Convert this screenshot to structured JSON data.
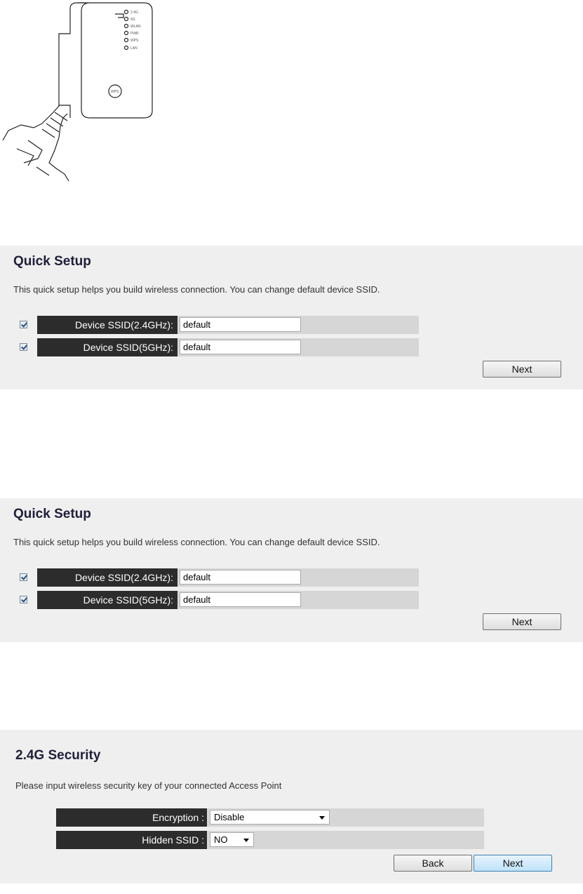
{
  "illustration": {
    "led_labels": [
      "2.4G",
      "5G",
      "WLAN",
      "PWR",
      "WPS",
      "LAN"
    ],
    "wps_label": "WPS"
  },
  "quick_setup_1": {
    "title": "Quick Setup",
    "description": "This quick setup helps you build wireless connection. You can change default device SSID.",
    "rows": [
      {
        "label": "Device SSID(2.4GHz):",
        "value": "default",
        "checked": true
      },
      {
        "label": "Device SSID(5GHz):",
        "value": "default",
        "checked": true
      }
    ],
    "next_label": "Next"
  },
  "quick_setup_2": {
    "title": "Quick Setup",
    "description": "This quick setup helps you build wireless connection. You can change default device SSID.",
    "rows": [
      {
        "label": "Device SSID(2.4GHz):",
        "value": "default",
        "checked": true
      },
      {
        "label": "Device SSID(5GHz):",
        "value": "default",
        "checked": true
      }
    ],
    "next_label": "Next"
  },
  "security": {
    "title": "2.4G Security",
    "description": "Please input wireless security key of your connected Access Point",
    "encryption_label": "Encryption :",
    "encryption_value": "Disable",
    "hidden_ssid_label": "Hidden SSID :",
    "hidden_ssid_value": "NO",
    "back_label": "Back",
    "next_label": "Next"
  }
}
